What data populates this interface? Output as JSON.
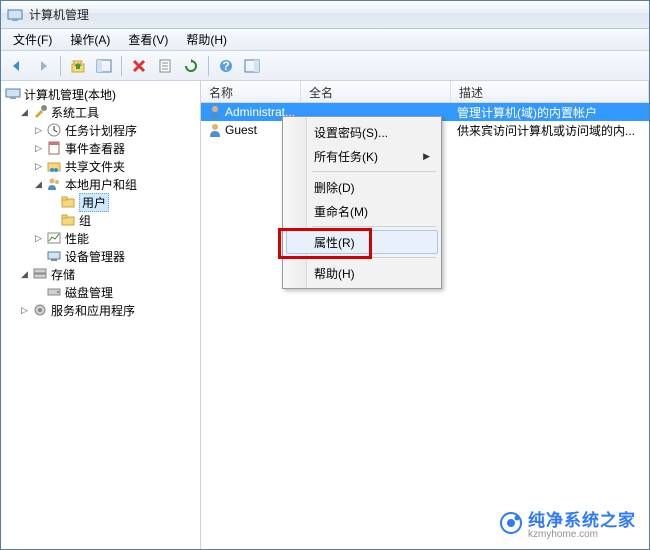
{
  "window": {
    "title": "计算机管理"
  },
  "menubar": {
    "file": "文件(F)",
    "action": "操作(A)",
    "view": "查看(V)",
    "help": "帮助(H)"
  },
  "tree": {
    "root": "计算机管理(本地)",
    "system_tools": "系统工具",
    "task_scheduler": "任务计划程序",
    "event_viewer": "事件查看器",
    "shared_folders": "共享文件夹",
    "local_users": "本地用户和组",
    "users": "用户",
    "groups": "组",
    "performance": "性能",
    "device_manager": "设备管理器",
    "storage": "存储",
    "disk_management": "磁盘管理",
    "services_apps": "服务和应用程序"
  },
  "list": {
    "columns": {
      "name": "名称",
      "fullname": "全名",
      "description": "描述"
    },
    "rows": [
      {
        "name": "Administrat...",
        "fullname": "",
        "description": "管理计算机(域)的内置帐户",
        "selected": true
      },
      {
        "name": "Guest",
        "fullname": "",
        "description": "供来宾访问计算机或访问域的内...",
        "selected": false
      }
    ]
  },
  "context_menu": {
    "set_password": "设置密码(S)...",
    "all_tasks": "所有任务(K)",
    "delete": "删除(D)",
    "rename": "重命名(M)",
    "properties": "属性(R)",
    "help": "帮助(H)"
  },
  "watermark": {
    "brand": "纯净系统之家",
    "url": "kzmyhome.com"
  }
}
